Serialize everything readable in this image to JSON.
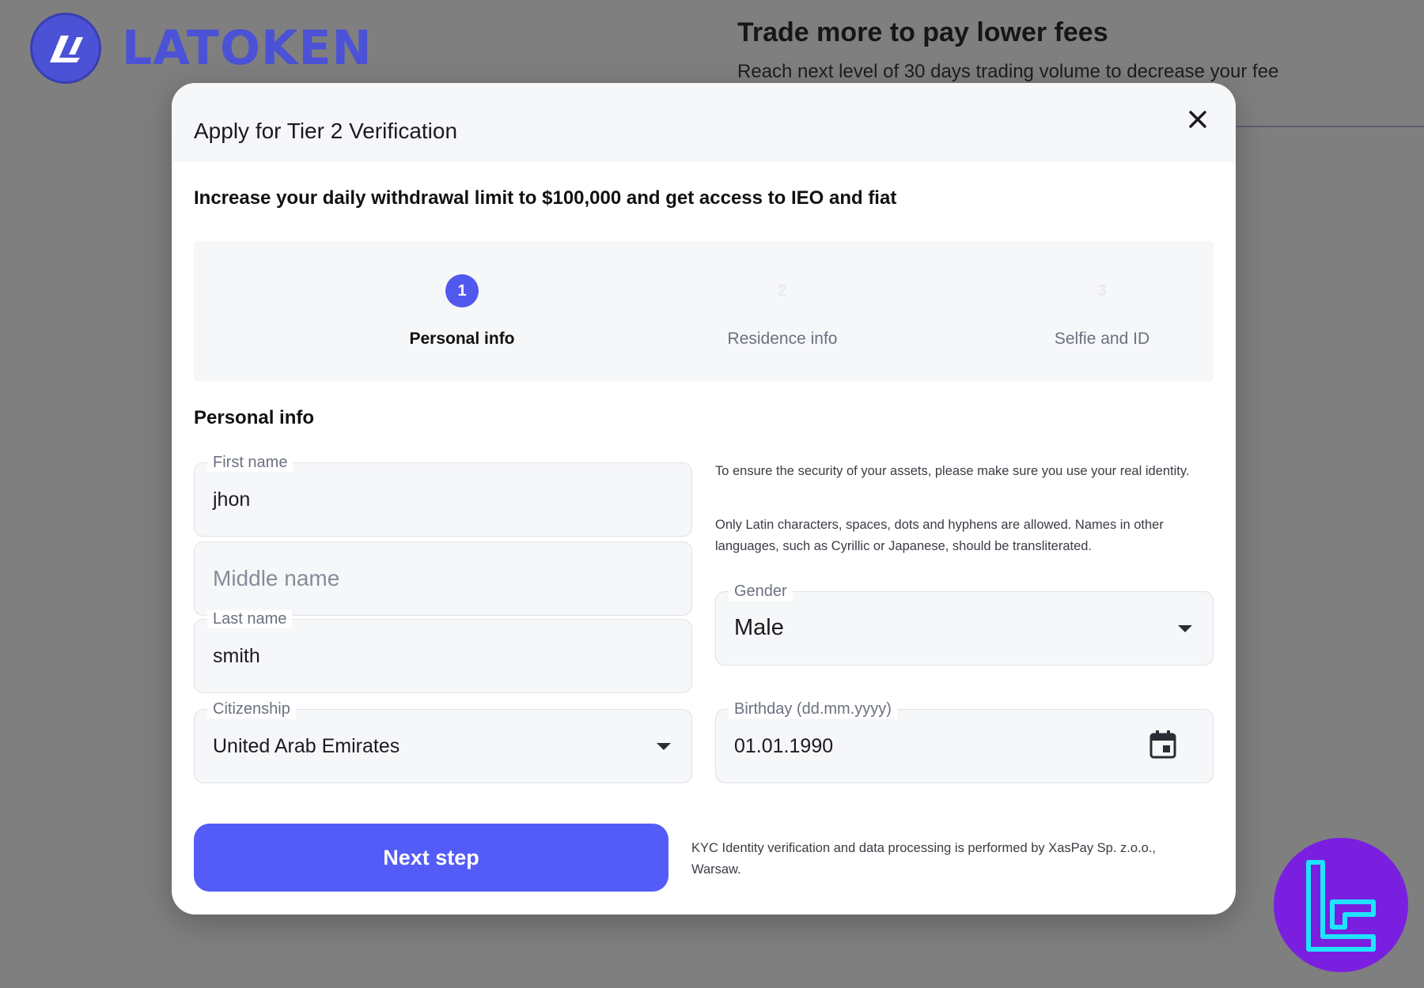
{
  "background": {
    "brand": "LATOKEN",
    "promo_title": "Trade more to pay lower fees",
    "promo_subtitle": "Reach next level of 30 days trading volume to decrease your fee"
  },
  "modal": {
    "title": "Apply for Tier 2 Verification",
    "subtitle": "Increase your daily withdrawal limit to $100,000 and get access to IEO and fiat",
    "steps": [
      {
        "number": "1",
        "label": "Personal info",
        "state": "active"
      },
      {
        "number": "2",
        "label": "Residence info",
        "state": "inactive"
      },
      {
        "number": "3",
        "label": "Selfie and ID",
        "state": "inactive"
      }
    ],
    "section_title": "Personal info",
    "fields": {
      "first_name": {
        "label": "First name",
        "value": "jhon"
      },
      "middle_name": {
        "placeholder": "Middle name"
      },
      "last_name": {
        "label": "Last name",
        "value": "smith"
      },
      "citizenship": {
        "label": "Citizenship",
        "value": "United Arab Emirates"
      },
      "gender": {
        "label": "Gender",
        "value": "Male"
      },
      "birthday": {
        "label": "Birthday (dd.mm.yyyy)",
        "value": "01.01.1990"
      }
    },
    "hint_security": "To ensure the security of your assets, please make sure you use your real identity.",
    "hint_latin": "Only Latin characters, spaces, dots and hyphens are allowed. Names in other languages, such as Cyrillic or Japanese, should be transliterated.",
    "next_button": "Next step",
    "kyc_note": "KYC Identity verification and data processing is performed by XasPay Sp. z.o.o., Warsaw."
  },
  "colors": {
    "accent": "#545cf7",
    "backdrop": "#7f7f7f",
    "field_bg": "#f6f7f9",
    "badge": "#7a1fe0"
  },
  "icons": [
    "latoken-logo-icon",
    "close-icon",
    "chevron-down-icon",
    "calendar-icon",
    "corner-logo-icon"
  ]
}
